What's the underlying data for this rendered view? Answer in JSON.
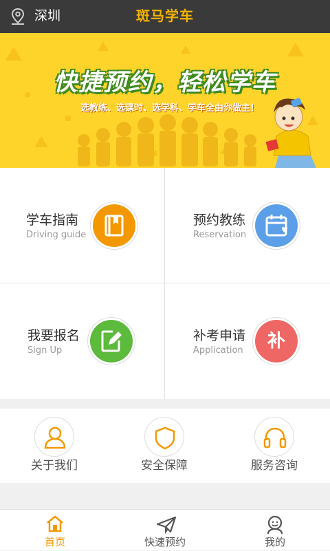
{
  "header": {
    "city": "深圳",
    "title": "斑马学车",
    "location_icon": "map-pin-icon"
  },
  "banner": {
    "headline": "快捷预约，轻松学车",
    "subline": "选教练、选课时、选学科、学车全由你做主！"
  },
  "features": [
    {
      "title": "学车指南",
      "subtitle": "Driving guide",
      "icon": "book-bookmark-icon",
      "color": "#f39800"
    },
    {
      "title": "预约教练",
      "subtitle": "Reservation",
      "icon": "calendar-heart-icon",
      "color": "#5b9fe8"
    },
    {
      "title": "我要报名",
      "subtitle": "Sign Up",
      "icon": "pen-edit-icon",
      "color": "#5cba3c"
    },
    {
      "title": "补考申请",
      "subtitle": "Application",
      "icon_text": "补",
      "color": "#ef6764"
    }
  ],
  "quick_links": [
    {
      "label": "关于我们",
      "icon": "user-icon"
    },
    {
      "label": "安全保障",
      "icon": "shield-icon"
    },
    {
      "label": "服务咨询",
      "icon": "headphones-icon"
    }
  ],
  "tabbar": {
    "active_color": "#f39800",
    "tabs": [
      {
        "label": "首页",
        "icon": "home-icon",
        "active": true
      },
      {
        "label": "快速预约",
        "icon": "paper-plane-icon",
        "active": false
      },
      {
        "label": "我的",
        "icon": "profile-icon",
        "active": false
      }
    ]
  }
}
